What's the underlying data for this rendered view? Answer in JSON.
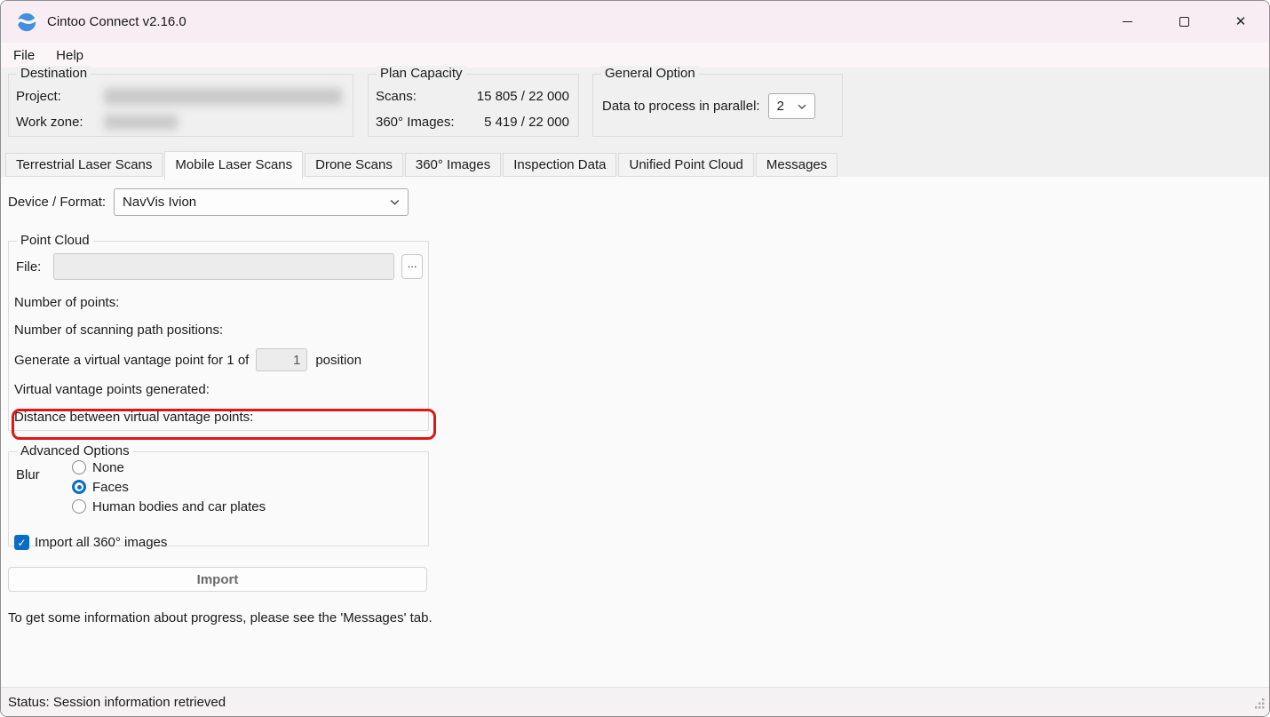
{
  "window": {
    "title": "Cintoo Connect v2.16.0"
  },
  "menu": {
    "file": "File",
    "help": "Help"
  },
  "destination": {
    "legend": "Destination",
    "project_label": "Project:",
    "workzone_label": "Work zone:"
  },
  "plan_capacity": {
    "legend": "Plan Capacity",
    "scans_label": "Scans:",
    "scans_value": "15 805 / 22 000",
    "images_label": "360° Images:",
    "images_value": "5 419 / 22 000"
  },
  "general_option": {
    "legend": "General Option",
    "parallel_label": "Data to process in parallel:",
    "parallel_value": "2"
  },
  "tabs": [
    {
      "label": "Terrestrial Laser Scans",
      "active": false
    },
    {
      "label": "Mobile Laser Scans",
      "active": true
    },
    {
      "label": "Drone Scans",
      "active": false
    },
    {
      "label": "360° Images",
      "active": false
    },
    {
      "label": "Inspection Data",
      "active": false
    },
    {
      "label": "Unified Point Cloud",
      "active": false
    },
    {
      "label": "Messages",
      "active": false
    }
  ],
  "device_format": {
    "label": "Device / Format:",
    "value": "NavVis Ivion"
  },
  "point_cloud": {
    "legend": "Point Cloud",
    "file_label": "File:",
    "file_value": "",
    "browse_label": "...",
    "num_points_label": "Number of points:",
    "num_path_positions_label": "Number of scanning path positions:",
    "vantage_prefix": "Generate a virtual vantage point for 1 of",
    "vantage_value": "1",
    "vantage_suffix": "position",
    "generated_label": "Virtual vantage points generated:",
    "distance_label": "Distance between virtual vantage points:"
  },
  "advanced_options": {
    "legend": "Advanced Options",
    "blur_label": "Blur",
    "radios": [
      {
        "label": "None",
        "selected": false
      },
      {
        "label": "Faces",
        "selected": true
      },
      {
        "label": "Human bodies and car plates",
        "selected": false
      }
    ],
    "checkbox_label": "Import all 360° images",
    "checkbox_checked": true
  },
  "import_button": {
    "label": "Import"
  },
  "info_text": "To get some information about progress, please see the 'Messages' tab.",
  "status_bar": {
    "text": "Status: Session information retrieved"
  },
  "colors": {
    "accent_blue": "#0a6cc5",
    "annotation_red": "#e01515",
    "titlebar_pink": "#f7edf2",
    "logo_blue": "#418fde"
  }
}
